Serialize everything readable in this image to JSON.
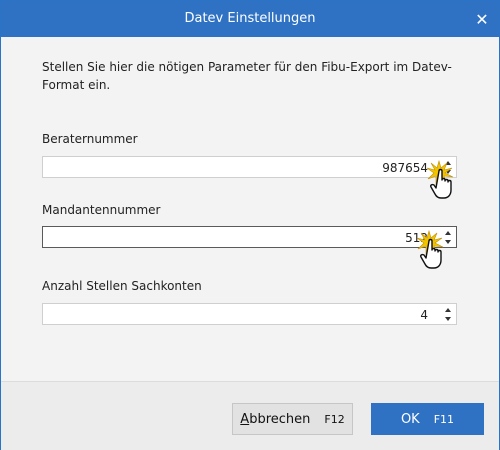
{
  "window": {
    "title": "Datev Einstellungen",
    "close_glyph": "✕"
  },
  "description": "Stellen Sie hier die nötigen Parameter für den Fibu-Export im Datev-Format ein.",
  "fields": [
    {
      "label": "Beraternummer",
      "value": "987654"
    },
    {
      "label": "Mandantennummer",
      "value": "512"
    },
    {
      "label": "Anzahl Stellen Sachkonten",
      "value": "4"
    }
  ],
  "buttons": {
    "cancel": {
      "label": "Abbrechen",
      "shortcut": "F12"
    },
    "ok": {
      "label": "OK",
      "shortcut": "F11"
    }
  },
  "colors": {
    "titlebar": "#2f72c4",
    "primary_button": "#2f72c4",
    "background": "#f3f3f3"
  },
  "icons": {
    "cursor": "hand-pointer-click-icon",
    "close": "close-icon",
    "spinner": "spinner-arrows-icon"
  }
}
